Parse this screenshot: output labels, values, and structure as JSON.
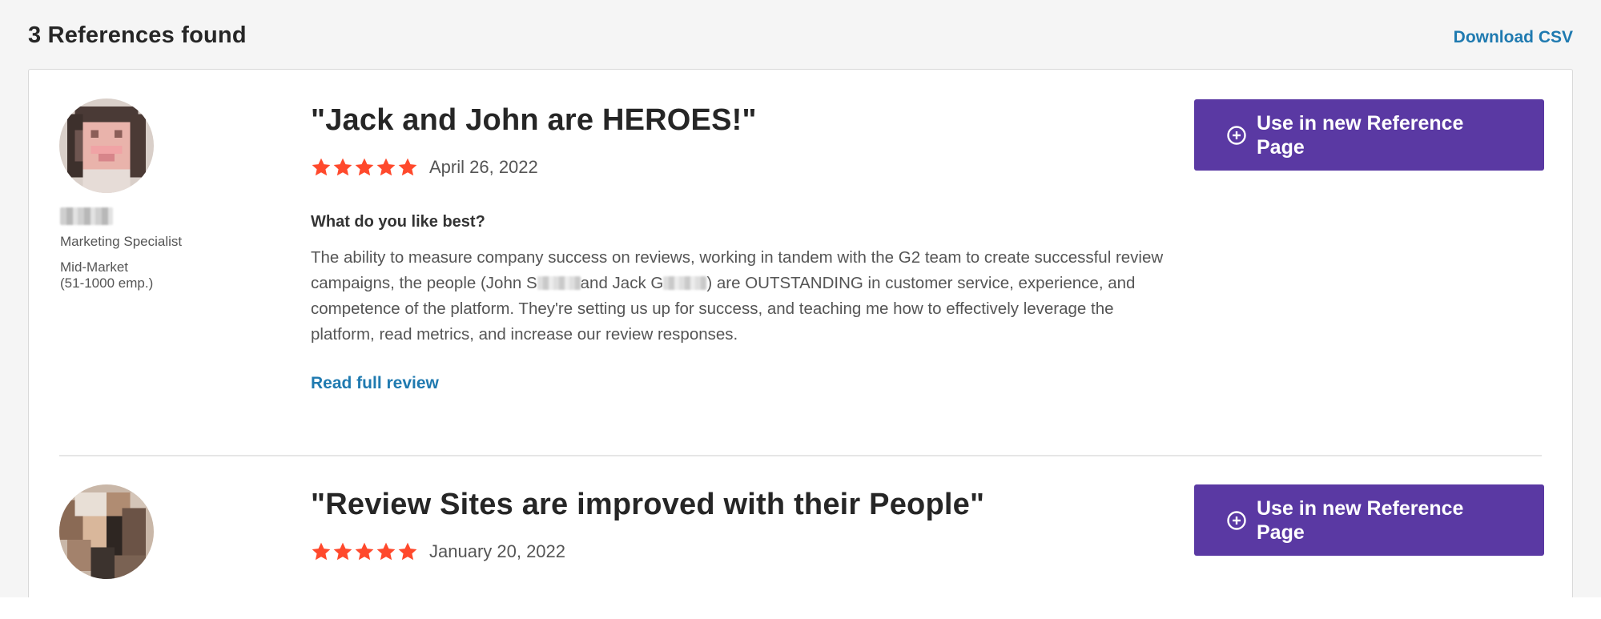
{
  "header": {
    "results_title": "3 References found",
    "download_label": "Download CSV"
  },
  "references": [
    {
      "reviewer": {
        "role": "Marketing Specialist",
        "segment": "Mid-Market",
        "segment_size": "(51-1000 emp.)"
      },
      "title": "\"Jack and John are HEROES!\"",
      "rating": 5,
      "date": "April 26, 2022",
      "question": "What do you like best?",
      "answer_parts": [
        "The ability to measure company success on reviews, working in tandem with the G2 team to create successful review campaigns, the people (John S",
        "and Jack G",
        ") are OUTSTANDING in customer service, experience, and competence of the platform. They're setting us up for success, and teaching me how to effectively leverage the platform, read metrics, and increase our review responses."
      ],
      "read_more_label": "Read full review",
      "action_label": "Use in new Reference Page"
    },
    {
      "title": "\"Review Sites are improved with their People\"",
      "rating": 5,
      "date": "January 20, 2022",
      "action_label": "Use in new Reference Page"
    }
  ],
  "icons": {
    "star": "star-icon",
    "plus": "plus-circle-icon"
  },
  "colors": {
    "star": "#ff492c",
    "action_button": "#5a39a3",
    "link": "#1f7ab0"
  }
}
